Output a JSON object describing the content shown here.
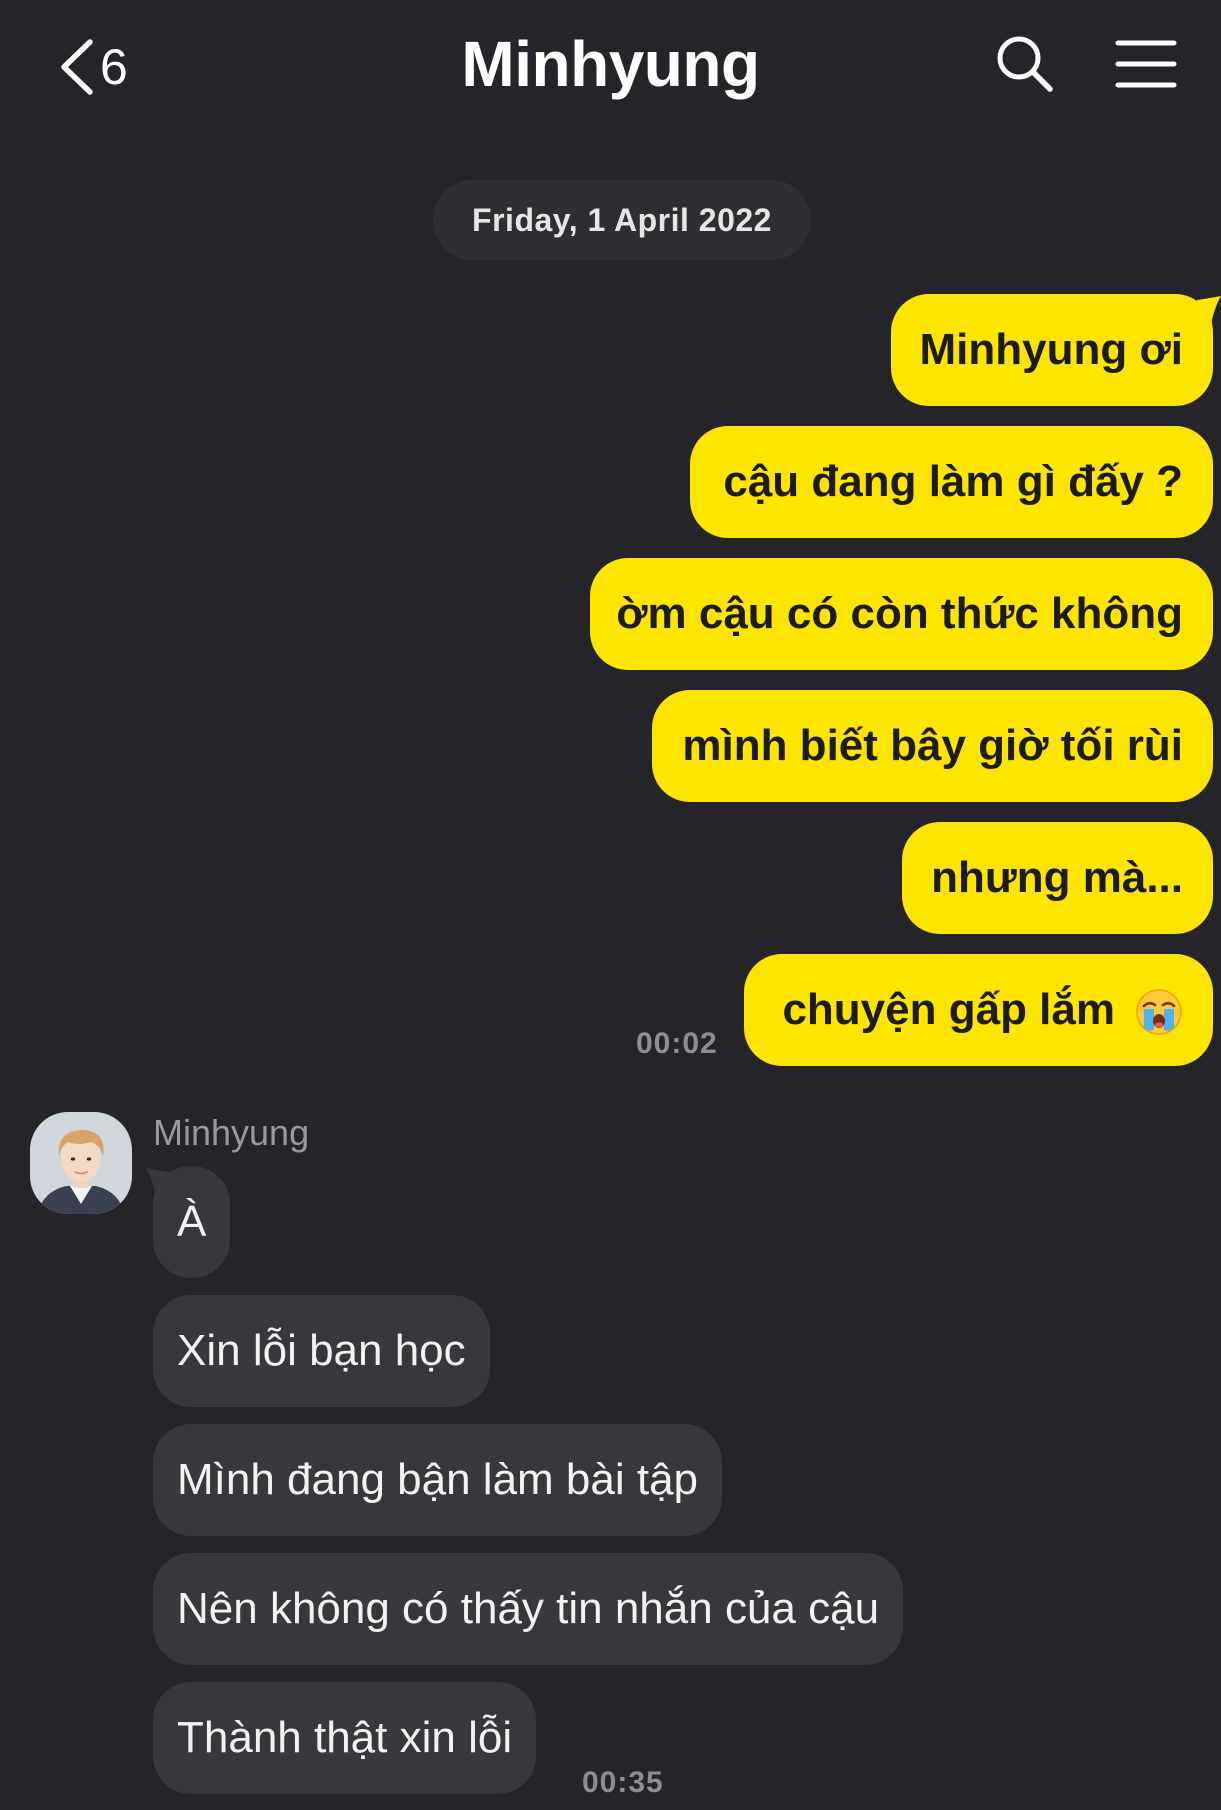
{
  "header": {
    "back_count": "6",
    "title": "Minhyung",
    "back_icon": "chevron-left-icon",
    "search_icon": "search-icon",
    "menu_icon": "hamburger-menu-icon"
  },
  "date_divider": "Friday, 1 April 2022",
  "outgoing": {
    "messages": [
      "Minhyung ơi",
      "cậu đang làm gì đấy ?",
      "ờm cậu có còn thức không",
      "mình biết bây giờ tối rùi",
      "nhưng mà...",
      "chuyện gấp lắm"
    ],
    "last_emoji": "loudly-crying-face-emoji",
    "time": "00:02"
  },
  "incoming": {
    "sender": "Minhyung",
    "avatar": "avatar",
    "messages": [
      "À",
      "Xin lỗi bạn học",
      "Mình đang bận làm bài tập",
      "Nên không có thấy tin nhắn của cậu",
      "Thành thật xin lỗi"
    ],
    "time": "00:35"
  },
  "colors": {
    "background": "#252529",
    "outgoing_bubble": "#fde500",
    "incoming_bubble": "#38383c",
    "date_pill": "#2f2f33",
    "timestamp": "#8d8d92"
  }
}
